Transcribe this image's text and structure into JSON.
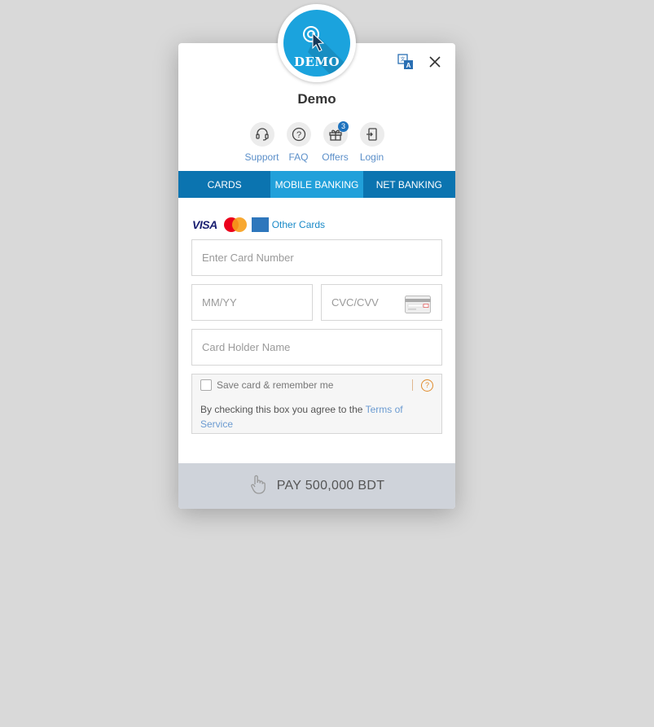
{
  "merchant": {
    "name": "Demo",
    "logo_text": "DEMO"
  },
  "header_icons": {
    "language": "translate-icon",
    "close": "close-icon"
  },
  "quick_links": [
    {
      "label": "Support",
      "icon": "headset-icon"
    },
    {
      "label": "FAQ",
      "icon": "question-icon"
    },
    {
      "label": "Offers",
      "icon": "gift-icon",
      "badge": "3"
    },
    {
      "label": "Login",
      "icon": "login-icon"
    }
  ],
  "tabs": [
    {
      "label": "CARDS",
      "active": false
    },
    {
      "label": "MOBILE BANKING",
      "active": true
    },
    {
      "label": "NET BANKING",
      "active": false
    }
  ],
  "card_brands": {
    "visa": "VISA",
    "other_cards": "Other Cards"
  },
  "form": {
    "card_number_placeholder": "Enter Card Number",
    "expiry_placeholder": "MM/YY",
    "cvc_placeholder": "CVC/CVV",
    "holder_placeholder": "Card Holder Name"
  },
  "save_card": {
    "label": "Save card & remember me",
    "help": "?",
    "terms_prefix": "By checking this box you agree to the ",
    "terms_link": "Terms of Service"
  },
  "pay_button": {
    "label": "PAY 500,000 BDT"
  },
  "colors": {
    "tab_bar": "#0b74b0",
    "tab_active": "#21a0da",
    "logo_bg": "#1ba3dd",
    "link": "#1a8ac8"
  }
}
